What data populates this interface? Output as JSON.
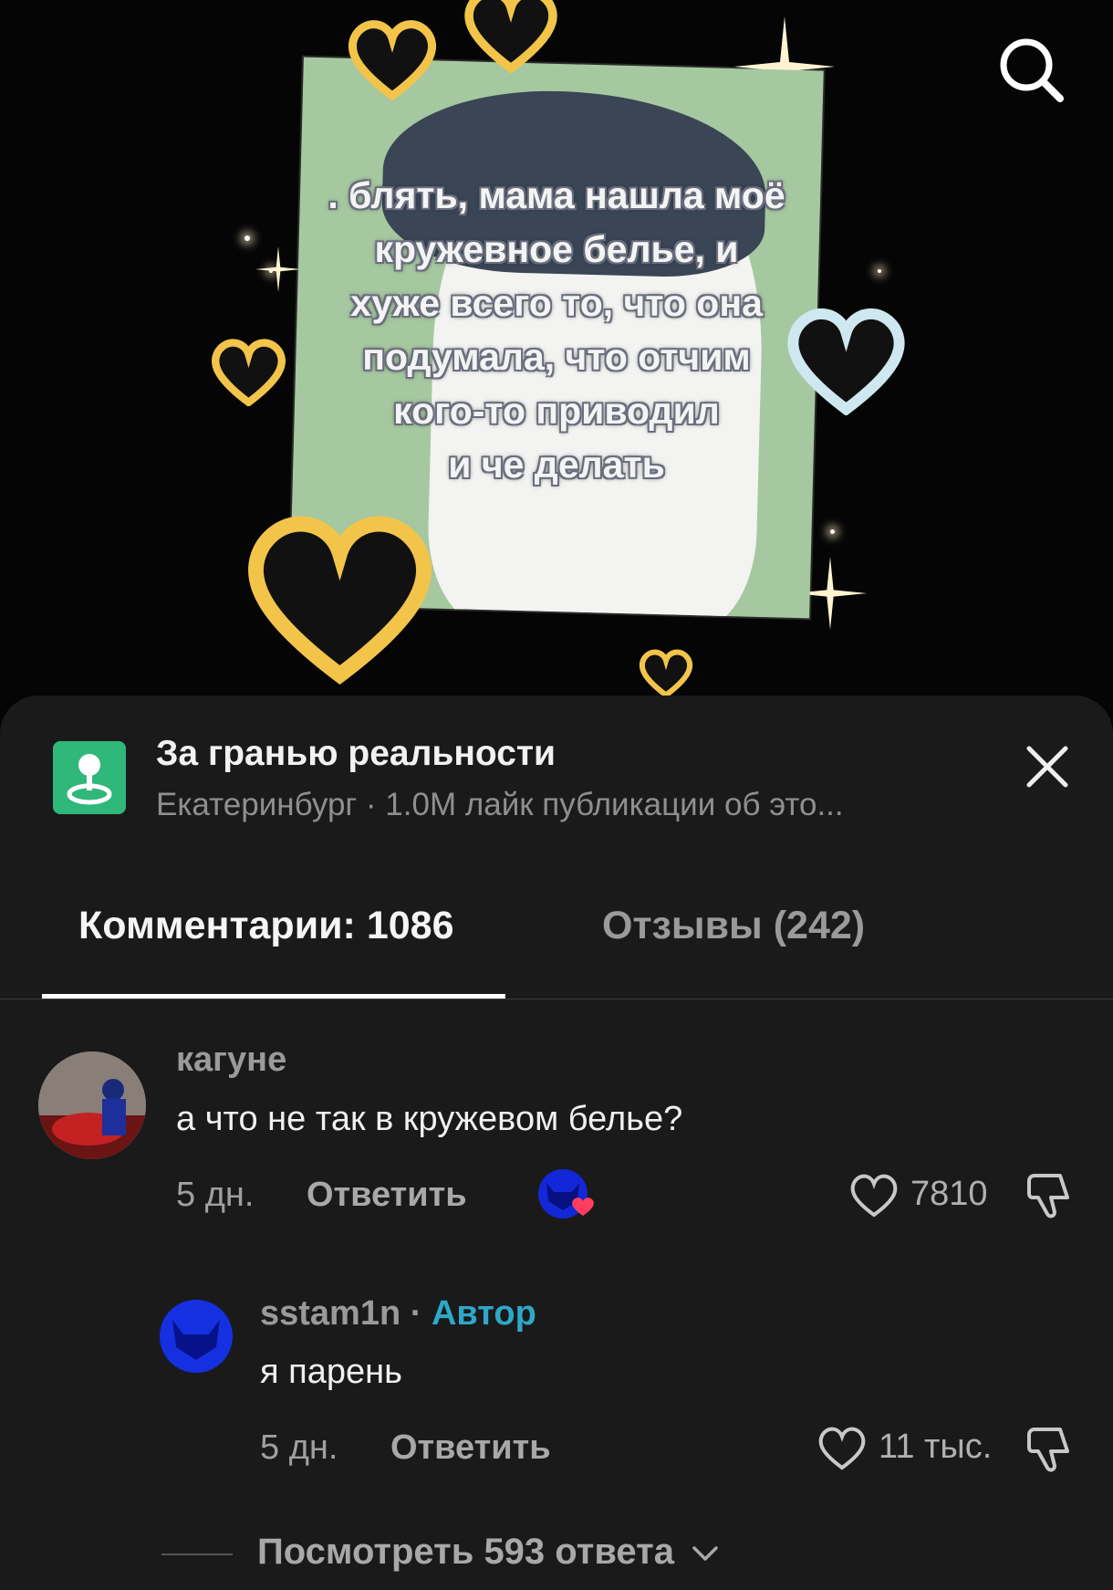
{
  "video": {
    "caption_lines": [
      ". блять, мама нашла моё",
      "кружевное белье, и",
      "хуже всего то, что она",
      "подумала, что отчим",
      "кого-то приводил",
      "и че делать"
    ],
    "search_icon": "search-icon"
  },
  "playlist": {
    "icon": "map-pin-icon",
    "title": "За гранью реальности",
    "subtitle": "Екатеринбург · 1.0M лайк публикации об это..."
  },
  "tabs": [
    {
      "label": "Комментарии: 1086",
      "active": true
    },
    {
      "label": "Отзывы (242)",
      "active": false
    }
  ],
  "comments": [
    {
      "username": "кагуне",
      "text": "а что не так в кружевом белье?",
      "time": "5 дн.",
      "reply_label": "Ответить",
      "likes": "7810",
      "creator_liked": true
    }
  ],
  "reply": {
    "username": "sstam1n",
    "separator": "·",
    "badge": "Автор",
    "text": "я парень",
    "time": "5 дн.",
    "reply_label": "Ответить",
    "likes": "11 тыс."
  },
  "view_replies_label": "Посмотреть 593 ответа",
  "colors": {
    "sheet_bg": "#1a1a1a",
    "author_badge": "#2ea8c8",
    "playlist_icon": "#2fb87a"
  }
}
